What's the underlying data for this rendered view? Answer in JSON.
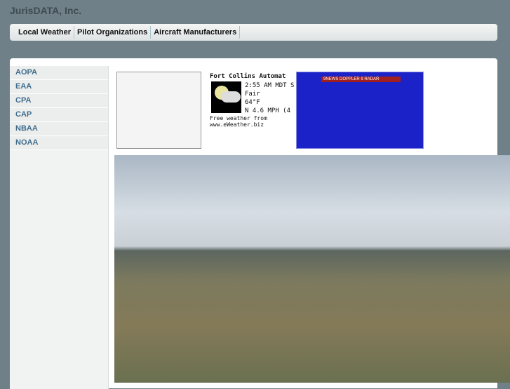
{
  "site": {
    "title": "JurisDATA, Inc."
  },
  "nav": {
    "items": [
      "Local Weather",
      "Pilot Organizations",
      "Aircraft Manufacturers"
    ]
  },
  "sidebar": {
    "items": [
      "AOPA",
      "EAA",
      "CPA",
      "CAP",
      "NBAA",
      "NOAA"
    ]
  },
  "weather": {
    "station": "Fort Collins Automat",
    "time": "2:55 AM MDT S",
    "condition": "Fair",
    "temp": "64°F",
    "wind": "N 4.6 MPH (4",
    "credit1": "Free weather from",
    "credit2": "www.eWeather.biz"
  },
  "radar": {
    "banner": "9NEWS DOPPLER 9 RADAR"
  }
}
